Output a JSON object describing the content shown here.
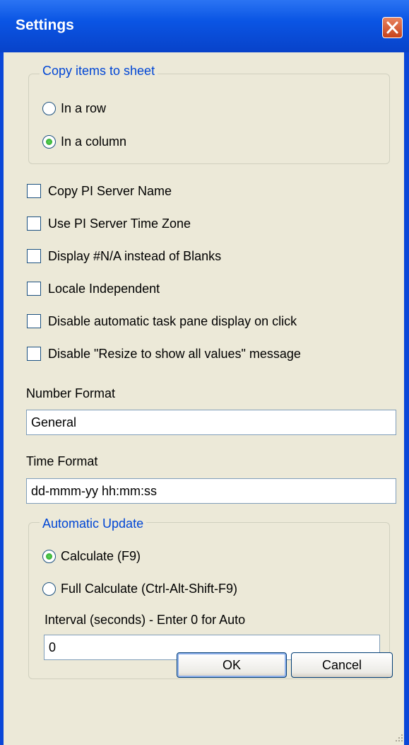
{
  "window": {
    "title": "Settings"
  },
  "copy_group": {
    "legend": "Copy items to sheet",
    "options": [
      {
        "label": "In a row",
        "selected": false
      },
      {
        "label": "In a column",
        "selected": true
      }
    ]
  },
  "checkboxes": [
    {
      "label": "Copy PI Server Name",
      "checked": false
    },
    {
      "label": "Use PI Server Time Zone",
      "checked": false
    },
    {
      "label": "Display #N/A instead of Blanks",
      "checked": false
    },
    {
      "label": "Locale Independent",
      "checked": false
    },
    {
      "label": "Disable automatic task pane display on click",
      "checked": false
    },
    {
      "label": "Disable \"Resize to show all values\" message",
      "checked": false
    }
  ],
  "number_format": {
    "label": "Number Format",
    "value": "General"
  },
  "time_format": {
    "label": "Time Format",
    "value": "dd-mmm-yy hh:mm:ss"
  },
  "update_group": {
    "legend": "Automatic Update",
    "options": [
      {
        "label": "Calculate (F9)",
        "selected": true
      },
      {
        "label": "Full  Calculate  (Ctrl-Alt-Shift-F9)",
        "selected": false
      }
    ],
    "interval_label": "Interval (seconds) - Enter 0 for Auto",
    "interval_value": "0"
  },
  "buttons": {
    "ok": "OK",
    "cancel": "Cancel"
  },
  "colors": {
    "title_bar": "#0a55e4",
    "face": "#ece9d8",
    "legend_text": "#0046d5",
    "close": "#d6582f"
  }
}
